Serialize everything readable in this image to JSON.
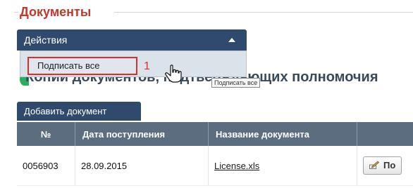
{
  "section": {
    "title": "Документы"
  },
  "actions": {
    "label": "Действия",
    "menu": [
      {
        "label": "Подписать все"
      }
    ],
    "marker": "1",
    "tooltip": "Подписать все"
  },
  "partial_heading": "Копии документов, подтверждающих полномочия",
  "add_document_label": "Добавить документ",
  "table": {
    "headers": [
      "№",
      "Дата поступления",
      "Название документа",
      ""
    ],
    "rows": [
      {
        "number": "0056903",
        "date": "28.09.2015",
        "name": "License.xls",
        "action": "По"
      }
    ]
  }
}
